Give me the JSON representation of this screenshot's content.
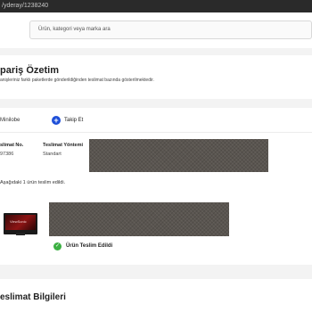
{
  "browser": {
    "url": "/yderay/1238240"
  },
  "search": {
    "placeholder": "Ürün, kategori veya marka ara"
  },
  "summary": {
    "title": "pariş Özetim",
    "description": "anişleriniz farklı paketlerde gönderildiğinden teslimat bazında gösterilmektedir."
  },
  "seller": {
    "name": "Minilobe",
    "follow_label": "Takip Et",
    "follow_icon": "plus-icon"
  },
  "delivery": {
    "number_label": "slimat No.",
    "number_value": "97386",
    "method_label": "Teslimat Yöntemi",
    "method_value": "Standart",
    "note": "Aşağıdaki 1 ürün teslim edildi."
  },
  "product": {
    "brand": "ViewSonic",
    "status": "Ürün Teslim Edildi",
    "status_icon": "check-circle-icon",
    "status_color": "#3cb043"
  },
  "shipping": {
    "title": "eslimat Bilgileri"
  },
  "colors": {
    "accent": "#1e4fd8",
    "success": "#3cb043"
  }
}
